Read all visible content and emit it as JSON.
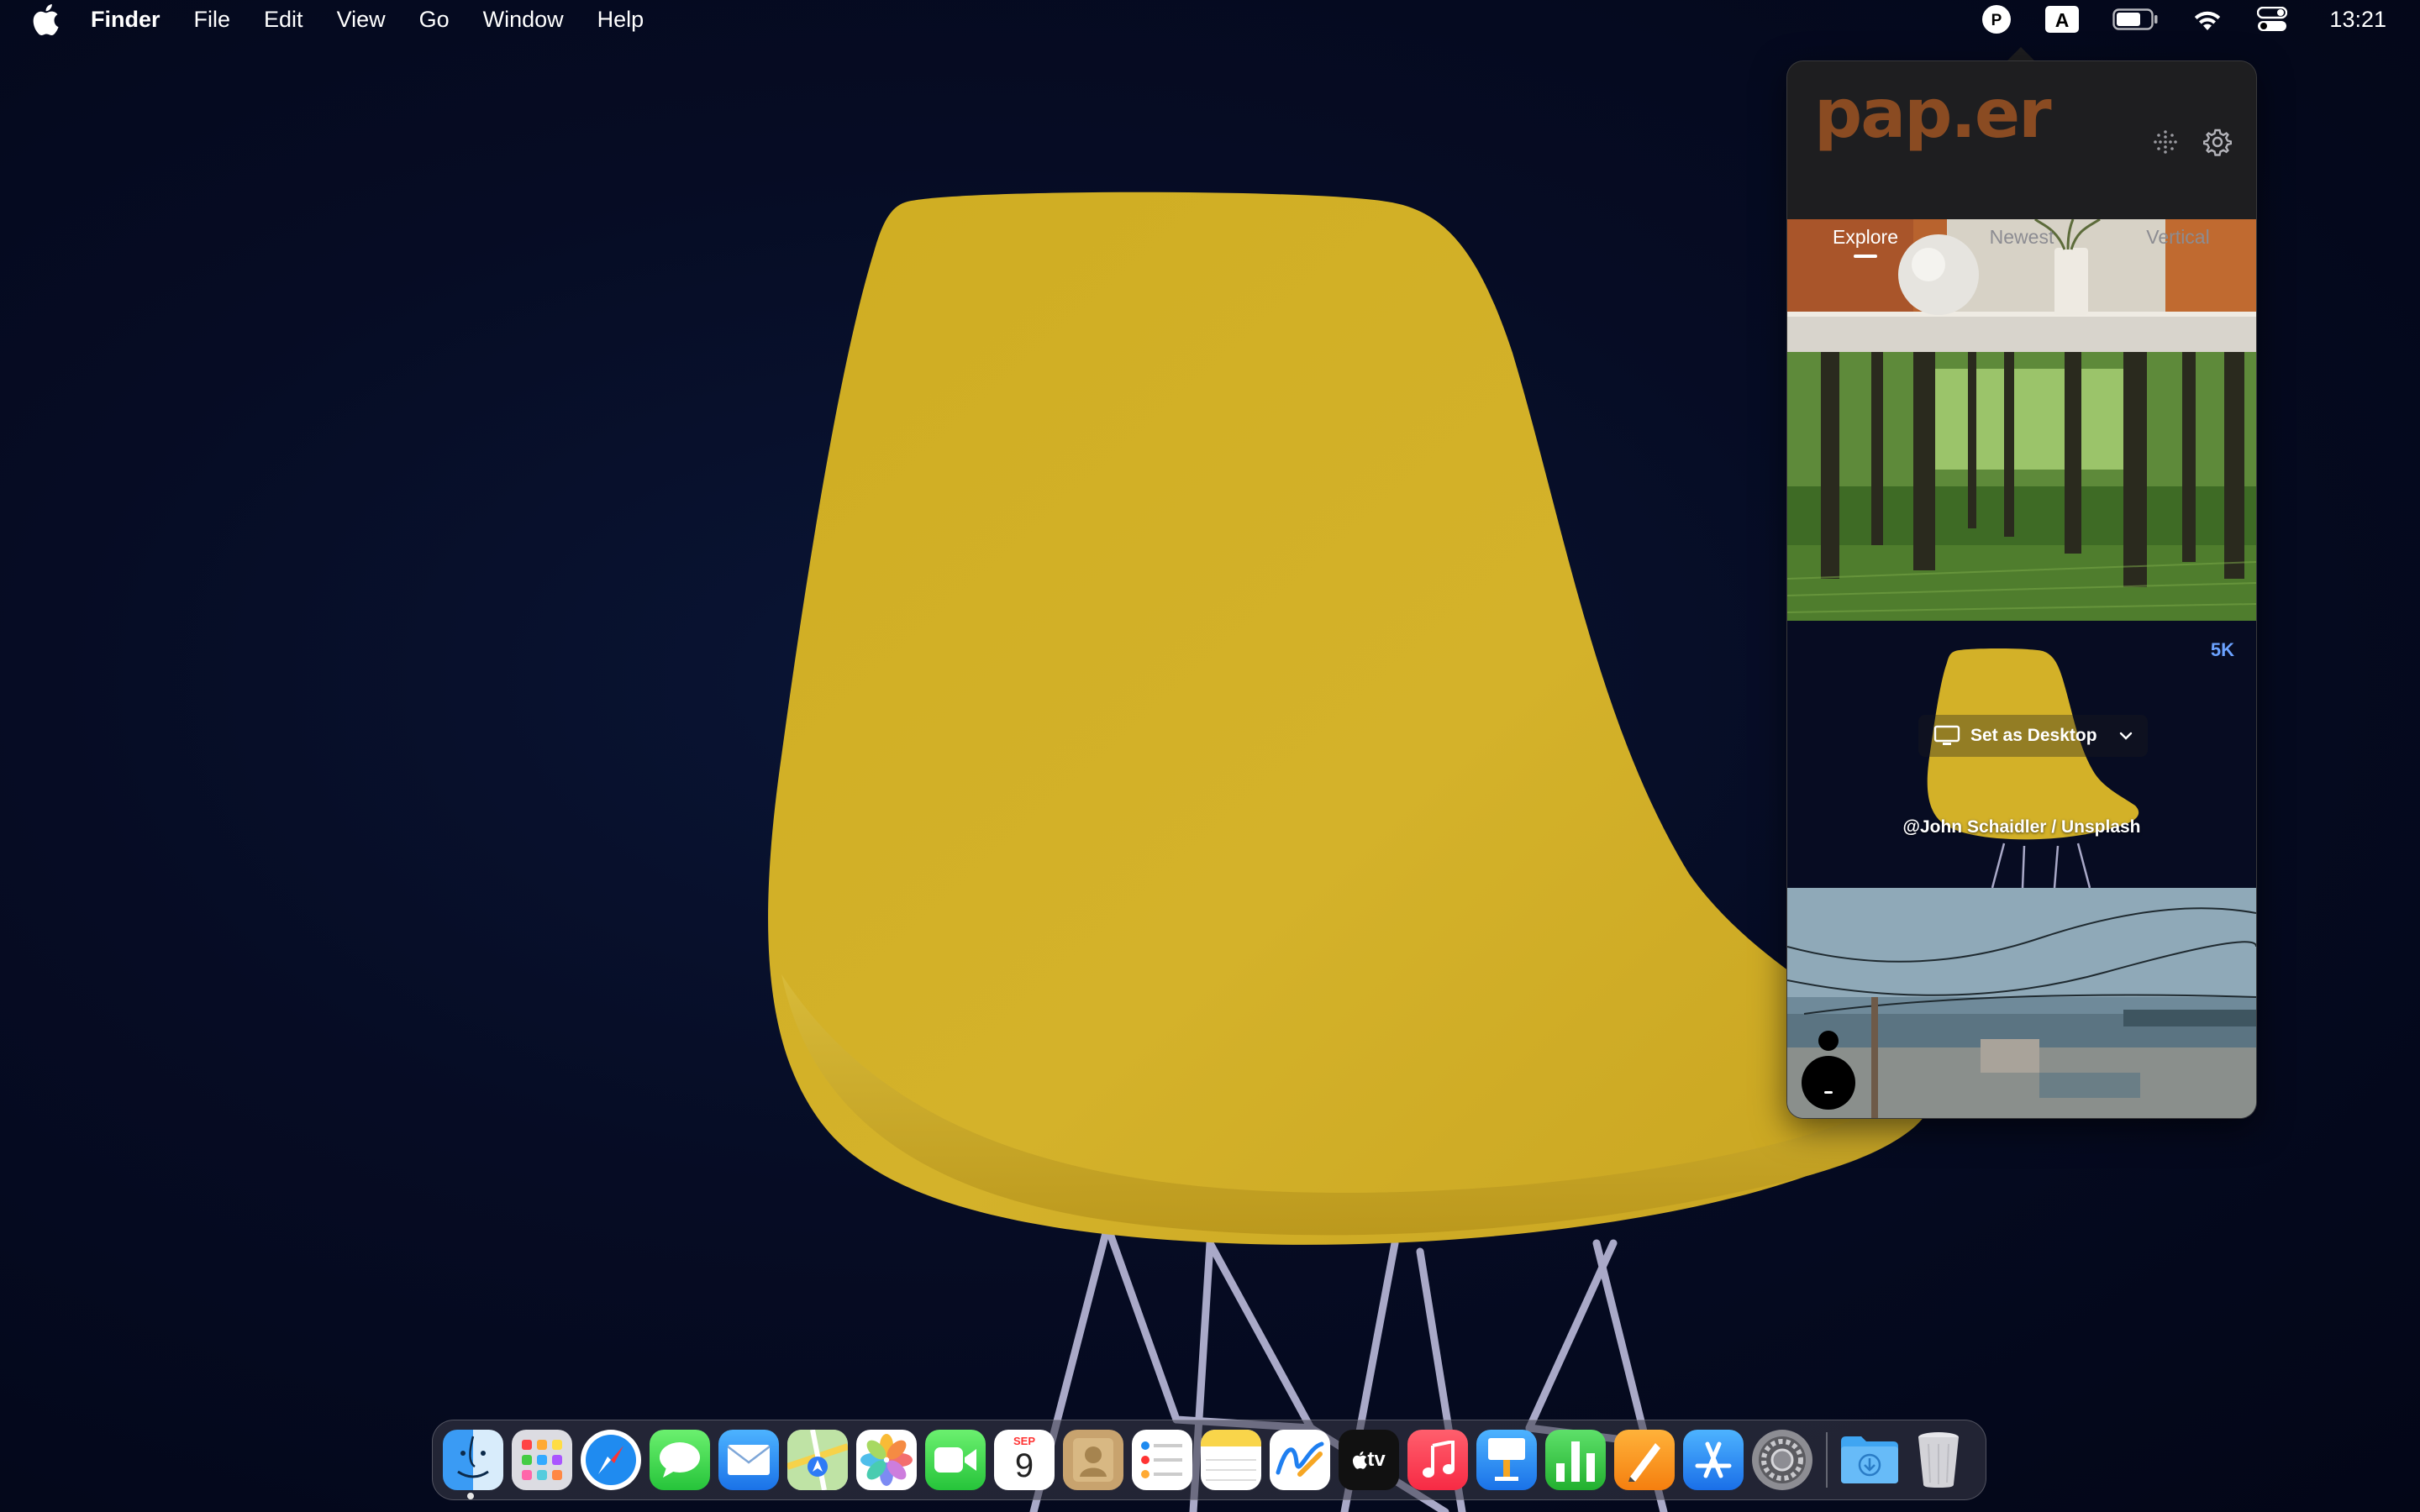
{
  "menubar": {
    "app_name": "Finder",
    "items": [
      "File",
      "Edit",
      "View",
      "Go",
      "Window",
      "Help"
    ],
    "status_icons": [
      "paper-app-icon",
      "input-source-icon",
      "battery-icon",
      "wifi-icon",
      "control-center-icon"
    ],
    "input_source_label": "A",
    "paper_status_label": "P",
    "clock": "13:21"
  },
  "popup": {
    "logo": "pap.er",
    "tabs": [
      {
        "label": "Explore",
        "active": true
      },
      {
        "label": "Newest",
        "active": false
      },
      {
        "label": "Vertical",
        "active": false
      }
    ],
    "thumbnails": [
      {
        "name": "orange-wall-sphere"
      },
      {
        "name": "green-forest"
      },
      {
        "name": "yellow-chair",
        "resolution_badge": "5K",
        "action_label": "Set as Desktop",
        "credit": "@John Schaidler / Unsplash"
      },
      {
        "name": "beach-string-lights"
      }
    ]
  },
  "dock": {
    "apps": [
      {
        "name": "Finder",
        "running": true
      },
      {
        "name": "Launchpad"
      },
      {
        "name": "Safari"
      },
      {
        "name": "Messages"
      },
      {
        "name": "Mail"
      },
      {
        "name": "Maps"
      },
      {
        "name": "Photos"
      },
      {
        "name": "FaceTime"
      },
      {
        "name": "Calendar",
        "month": "SEP",
        "day": "9"
      },
      {
        "name": "Contacts"
      },
      {
        "name": "Reminders"
      },
      {
        "name": "Notes"
      },
      {
        "name": "Freeform"
      },
      {
        "name": "TV",
        "label": "tv"
      },
      {
        "name": "Music"
      },
      {
        "name": "Keynote"
      },
      {
        "name": "Numbers"
      },
      {
        "name": "Pages"
      },
      {
        "name": "App Store"
      },
      {
        "name": "System Settings"
      }
    ],
    "folders": [
      {
        "name": "Downloads"
      },
      {
        "name": "Trash"
      }
    ]
  },
  "colors": {
    "accent_logo": "#8a4b22",
    "badge_blue": "#6ba2ff",
    "chair_yellow": "#d8b62c",
    "wallpaper_navy": "#050a1e"
  }
}
